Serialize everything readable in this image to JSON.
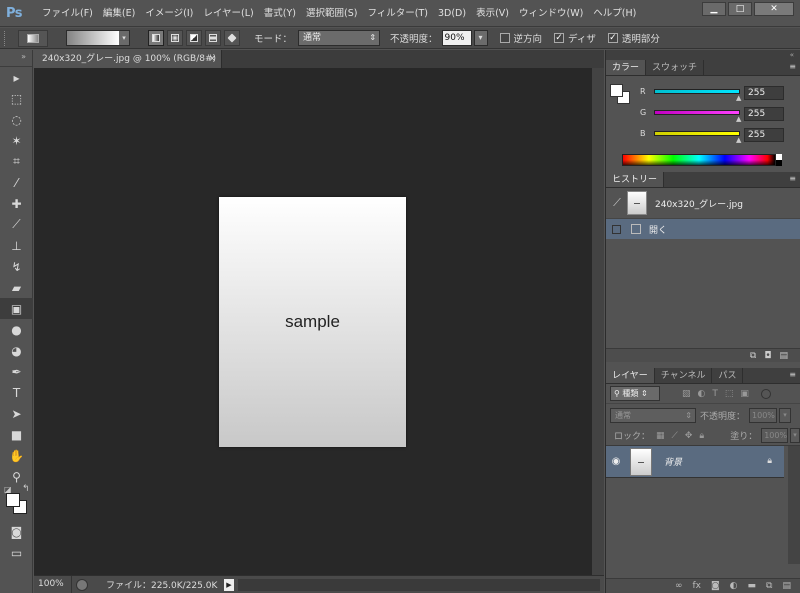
{
  "app": {
    "logo": "Ps"
  },
  "menu": [
    "ファイル(F)",
    "編集(E)",
    "イメージ(I)",
    "レイヤー(L)",
    "書式(Y)",
    "選択範囲(S)",
    "フィルター(T)",
    "3D(D)",
    "表示(V)",
    "ウィンドウ(W)",
    "ヘルプ(H)"
  ],
  "window_controls": {
    "minimize": "▁",
    "maximize": "□",
    "close": "✕"
  },
  "options": {
    "mode_label": "モード：",
    "mode_value": "通常",
    "opacity_label": "不透明度：",
    "opacity_value": "90%",
    "reverse_label": "逆方向",
    "reverse_checked": false,
    "dither_label": "ディザ",
    "dither_checked": true,
    "transparency_label": "透明部分",
    "transparency_checked": true
  },
  "document": {
    "tab_title": "240x320_グレー.jpg @ 100% (RGB/8#)",
    "tab_close": "×",
    "image_text": "sample"
  },
  "status": {
    "zoom": "100%",
    "file_info": "ファイル：225.0K/225.0K",
    "arrow": "▶"
  },
  "tools": [
    {
      "icon": "move-icon",
      "glyph": "▸"
    },
    {
      "icon": "marquee-icon",
      "glyph": "⬚"
    },
    {
      "icon": "lasso-icon",
      "glyph": "◌"
    },
    {
      "icon": "magic-wand-icon",
      "glyph": "✶"
    },
    {
      "icon": "crop-icon",
      "glyph": "⌗"
    },
    {
      "icon": "eyedropper-icon",
      "glyph": "⁄"
    },
    {
      "icon": "healing-brush-icon",
      "glyph": "✚"
    },
    {
      "icon": "brush-icon",
      "glyph": "⟋"
    },
    {
      "icon": "clone-stamp-icon",
      "glyph": "⊥"
    },
    {
      "icon": "history-brush-icon",
      "glyph": "↯"
    },
    {
      "icon": "eraser-icon",
      "glyph": "▰"
    },
    {
      "icon": "gradient-icon",
      "glyph": "▣",
      "active": true
    },
    {
      "icon": "blur-icon",
      "glyph": "●"
    },
    {
      "icon": "dodge-icon",
      "glyph": "◕"
    },
    {
      "icon": "pen-icon",
      "glyph": "✒"
    },
    {
      "icon": "type-icon",
      "glyph": "T"
    },
    {
      "icon": "path-selection-icon",
      "glyph": "➤"
    },
    {
      "icon": "rectangle-shape-icon",
      "glyph": "■"
    },
    {
      "icon": "hand-icon",
      "glyph": "✋"
    },
    {
      "icon": "zoom-icon",
      "glyph": "⚲"
    }
  ],
  "color_panel": {
    "tabs": [
      "カラー",
      "スウォッチ"
    ],
    "active_tab": 0,
    "r_label": "R",
    "r_value": "255",
    "r_color": "#00e5ff",
    "g_label": "G",
    "g_value": "255",
    "g_color": "#ff40ff",
    "b_label": "B",
    "b_value": "255",
    "b_color": "#ffff00",
    "foreground": "#ffffff",
    "background": "#ffffff"
  },
  "history_panel": {
    "tabs": [
      "ヒストリー"
    ],
    "snapshot_label": "240x320_グレー.jpg",
    "items": [
      {
        "label": "開く"
      }
    ]
  },
  "layers_panel": {
    "tabs": [
      "レイヤー",
      "チャンネル",
      "パス"
    ],
    "filter_label": "種類",
    "blend_value": "通常",
    "opacity_label": "不透明度：",
    "opacity_value": "100%",
    "lock_label": "ロック：",
    "fill_label": "塗り：",
    "fill_value": "100%",
    "layers": [
      {
        "name": "背景",
        "visible": true,
        "locked": true
      }
    ]
  }
}
